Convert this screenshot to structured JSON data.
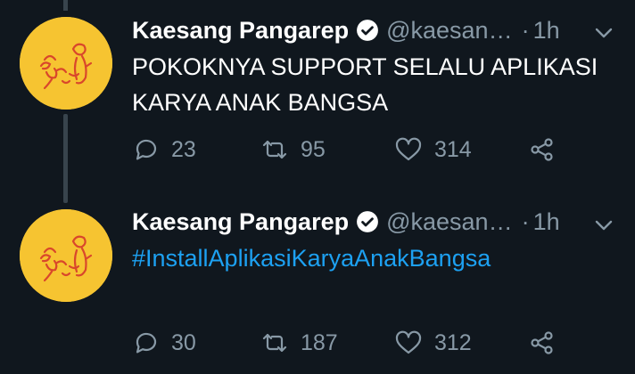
{
  "colors": {
    "background": "#10171e",
    "text_primary": "#ffffff",
    "text_secondary": "#8899a6",
    "link": "#1da1f2",
    "avatar_bg": "#f6c431",
    "thread_line": "#38444d"
  },
  "tweets": [
    {
      "author_name": "Kaesang Pangarep",
      "handle": "@kaesan…",
      "separator": "·",
      "time": "1h",
      "text": "POKOKNYA SUPPORT SELALU APLIKASI KARYA ANAK BANGSA",
      "replies": "23",
      "retweets": "95",
      "likes": "314"
    },
    {
      "author_name": "Kaesang Pangarep",
      "handle": "@kaesan…",
      "separator": "·",
      "time": "1h",
      "text": "#InstallAplikasiKaryaAnakBangsa",
      "replies": "30",
      "retweets": "187",
      "likes": "312"
    }
  ],
  "icons": {
    "verified": "verified-badge-icon",
    "chevron": "chevron-down-icon",
    "reply": "reply-icon",
    "retweet": "retweet-icon",
    "like": "heart-icon",
    "share": "share-icon"
  }
}
